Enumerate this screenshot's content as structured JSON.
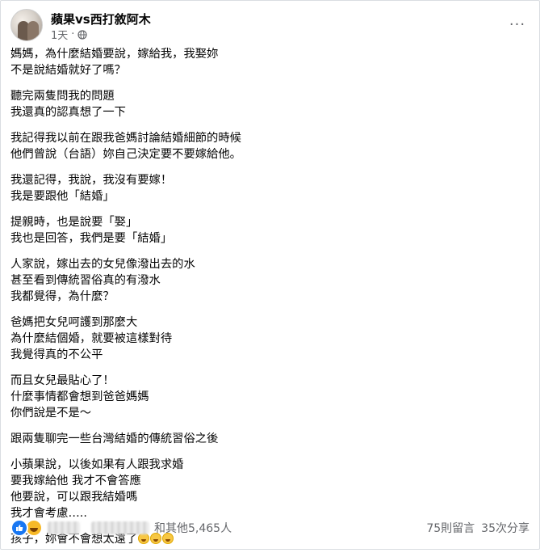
{
  "post": {
    "author": "蘋果vs西打敘阿木",
    "time": "1天",
    "more_label": "···",
    "paragraphs": [
      [
        "媽媽，為什麼結婚要說，嫁給我，我娶妳",
        "不是說結婚就好了嗎？"
      ],
      [
        "聽完兩隻問我的問題",
        "我還真的認真想了一下"
      ],
      [
        "我記得我以前在跟我爸媽討論結婚細節的時候",
        "他們曾說（台語）妳自己決定要不要嫁給他。"
      ],
      [
        "我還記得，我說，我沒有要嫁！",
        "我是要跟他「結婚」"
      ],
      [
        "提親時，也是說要「娶」",
        "我也是回答，我們是要「結婚」"
      ],
      [
        "人家說，嫁出去的女兒像潑出去的水",
        "甚至看到傳統習俗真的有潑水",
        "我都覺得，為什麼？"
      ],
      [
        "爸媽把女兒呵護到那麼大",
        "為什麼結個婚，就要被這樣對待",
        "我覺得真的不公平"
      ],
      [
        "而且女兒最貼心了！",
        "什麼事情都會想到爸爸媽媽",
        "你們說是不是～"
      ],
      [
        "跟兩隻聊完一些台灣結婚的傳統習俗之後"
      ],
      [
        "小蘋果說，以後如果有人跟我求婚",
        "要我嫁給他 我才不會答應",
        "他要說，可以跟我結婚嗎",
        "我才會考慮….."
      ]
    ],
    "last_line": "孩子，妳會不會想太遠了"
  },
  "footer": {
    "others": "和其他5,465人",
    "comments": "75則留言",
    "shares": "35次分享"
  },
  "colors": {
    "like": "#1877f2",
    "haha": "#f7b928",
    "meta": "#65676b"
  }
}
